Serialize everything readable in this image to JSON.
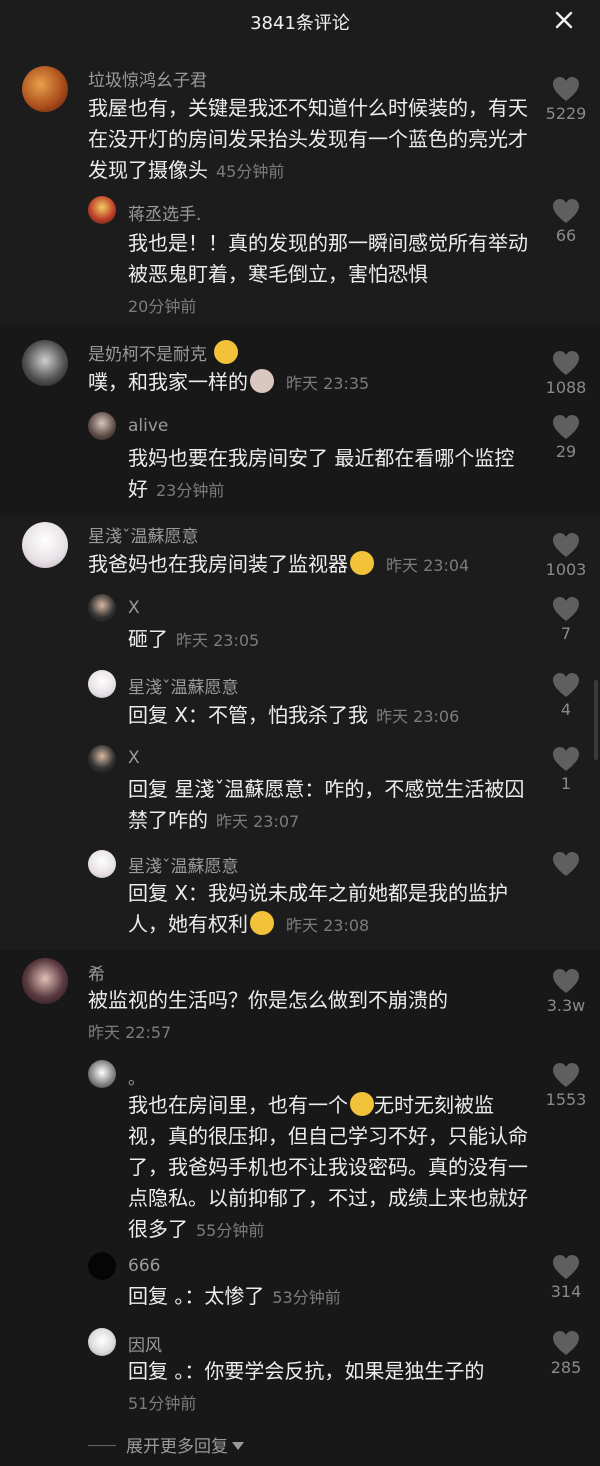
{
  "header": {
    "title": "3841条评论",
    "close_label": "×"
  },
  "threads": [
    {
      "user": "垃圾惊鸿幺子君",
      "text": "我屋也有，关键是我还不知道什么时候装的，有天在没开灯的房间发呆抬头发现有一个蓝色的亮光才发现了摄像头",
      "time": "45分钟前",
      "likes": "5229",
      "replies": [
        {
          "user": "蒋丞选手.",
          "text": "我也是！！真的发现的那一瞬间感觉所有举动被恶鬼盯着，寒毛倒立，害怕恐惧",
          "time": "20分钟前",
          "likes": "66"
        }
      ]
    },
    {
      "user": "是奶柯不是耐克",
      "text": "噗，和我家一样的",
      "time": "昨天 23:35",
      "likes": "1088",
      "replies": [
        {
          "user": "alive",
          "text": "我妈也要在我房间安了 最近都在看哪个监控好",
          "time": "23分钟前",
          "likes": "29"
        }
      ]
    },
    {
      "user": "星淺ˇ温蘇愿意",
      "text": "我爸妈也在我房间装了监视器",
      "time": "昨天 23:04",
      "likes": "1003",
      "replies": [
        {
          "user": "X",
          "text": "砸了",
          "time": "昨天 23:05",
          "likes": "7"
        },
        {
          "user": "星淺ˇ温蘇愿意",
          "text": "回复 X：不管，怕我杀了我",
          "time": "昨天 23:06",
          "likes": "4"
        },
        {
          "user": "X",
          "text": "回复 星淺ˇ温蘇愿意：咋的，不感觉生活被囚禁了咋的",
          "time": "昨天 23:07",
          "likes": "1"
        },
        {
          "user": "星淺ˇ温蘇愿意",
          "text": "回复 X：我妈说未成年之前她都是我的监护人，她有权利",
          "time": "昨天 23:08",
          "likes": ""
        }
      ]
    },
    {
      "user": "希",
      "text": "被监视的生活吗？你是怎么做到不崩溃的",
      "time": "昨天 22:57",
      "likes": "3.3w",
      "replies": [
        {
          "user": "。",
          "text_a": "我也在房间里，也有一个",
          "text_b": "无时无刻被监视，真的很压抑，但自己学习不好，只能认命了，我爸妈手机也不让我设密码。真的没有一点隐私。以前抑郁了，不过，成绩上来也就好很多了",
          "time": "55分钟前",
          "likes": "1553"
        },
        {
          "user": "666",
          "text": "回复 。：太惨了",
          "time": "53分钟前",
          "likes": "314"
        },
        {
          "user": "因风",
          "text": "回复 。：你要学会反抗，如果是独生子的",
          "time": "51分钟前",
          "likes": "285"
        }
      ]
    }
  ],
  "more_replies": "展开更多回复",
  "colors": {
    "bg": "#1c1c1d",
    "band": "#181818",
    "text": "#ededed",
    "meta": "#9a9a9a"
  }
}
